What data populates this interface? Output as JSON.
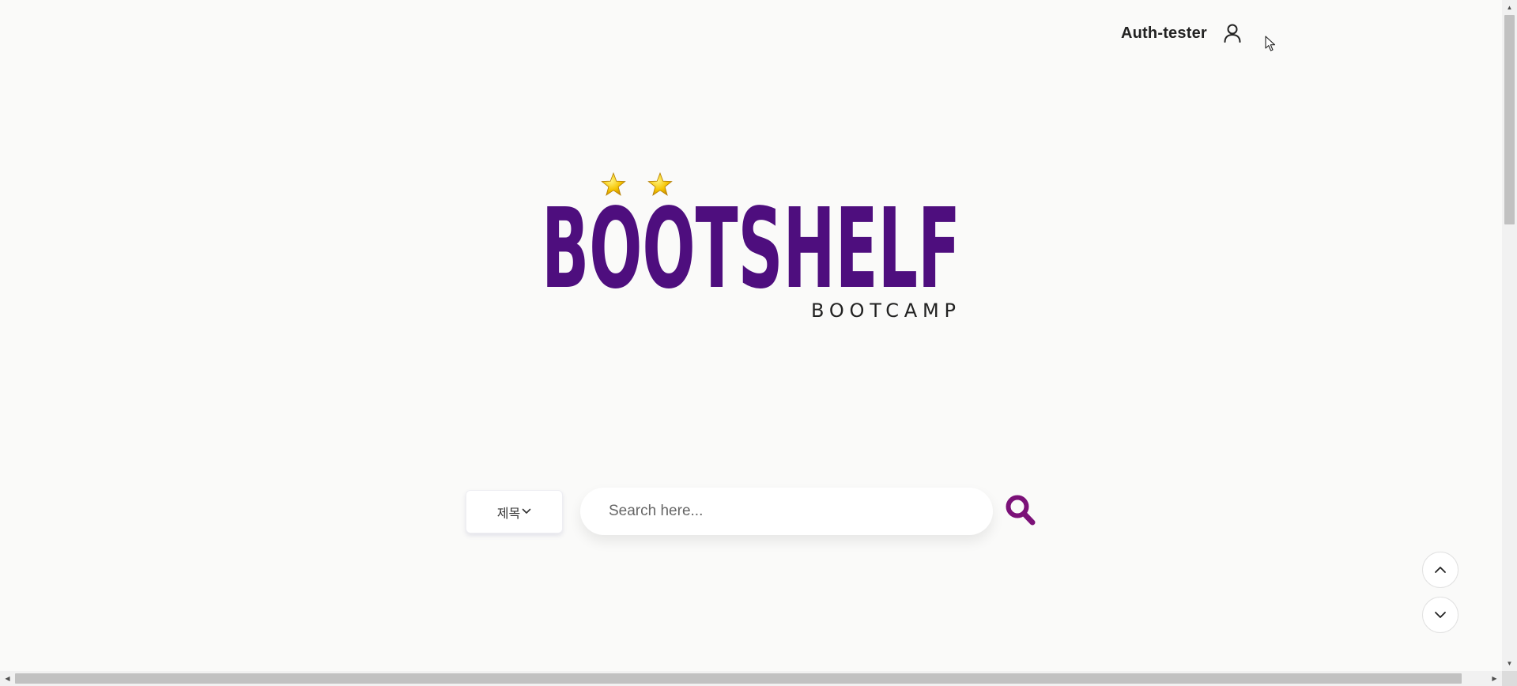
{
  "header": {
    "username": "Auth-tester",
    "user_icon": "user-icon"
  },
  "logo": {
    "brand": "BOOTSHELF",
    "subtitle": "BOOTCAMP",
    "brand_color": "#4e0e7e",
    "star_color": "#f5c400"
  },
  "search": {
    "category_selected": "제목",
    "placeholder": "Search here...",
    "input_value": "",
    "search_icon": "search-icon",
    "accent_color": "#7b1178"
  },
  "scroll_controls": {
    "up_icon": "chevron-up-icon",
    "down_icon": "chevron-down-icon"
  }
}
